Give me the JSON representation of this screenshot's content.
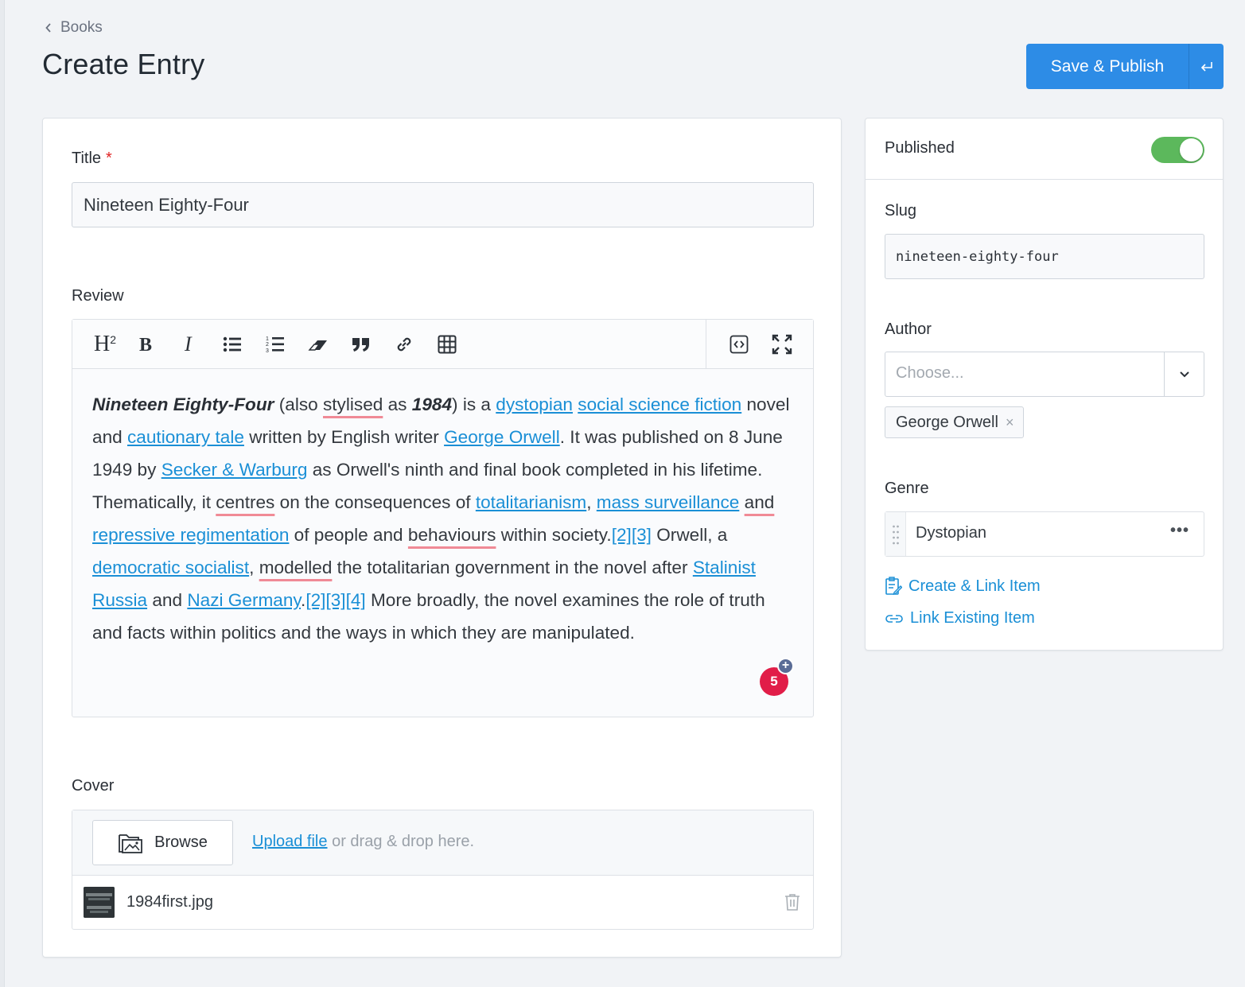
{
  "header": {
    "breadcrumb": "Books",
    "title": "Create Entry",
    "publish_label": "Save & Publish"
  },
  "form": {
    "title_label": "Title",
    "required_mark": "*",
    "title_value": "Nineteen Eighty-Four",
    "review_label": "Review",
    "review": {
      "t1": "Nineteen Eighty-Four",
      "t2": " (also ",
      "t3": "stylised",
      "t4": " as ",
      "t5": "1984",
      "t6": ") is a ",
      "l1": "dystopian",
      "t7": " ",
      "l2": "social science fiction",
      "t8": " novel and ",
      "l3": "cautionary tale",
      "t9": " written by English writer ",
      "l4": "George Orwell",
      "t10": ". It was published on 8 June 1949 by ",
      "l5": "Secker & Warburg",
      "t11": " as Orwell's ninth and final book completed in his lifetime. Thematically, it ",
      "t12": "centres",
      "t13": " on the consequences of ",
      "l6": "totalitarianism",
      "t14": ", ",
      "l7": "mass surveillance",
      "t15": " ",
      "t16": "and",
      "t17": " ",
      "l8": "repressive regimentation",
      "t18": " of people and ",
      "t19": "behaviours",
      "t20": " within society.",
      "l9": "[2]",
      "l10": "[3]",
      "t21": " Orwell, a ",
      "l11": "democratic socialist",
      "t22": ", ",
      "t23": "modelled",
      "t24": " the totalitarian government in the novel after ",
      "l12": "Stalinist Russia",
      "t25": " and ",
      "l13": "Nazi Germany",
      "t26": ".",
      "l14": "[2]",
      "l15": "[3]",
      "l16": "[4]",
      "t27": " More broadly, the novel examines the role of truth and facts within politics and the ways in which they are manipulated."
    },
    "grammar_count": "5",
    "grammar_plus": "+",
    "cover_label": "Cover",
    "browse_label": "Browse",
    "upload_link": "Upload file",
    "upload_hint": " or drag & drop here.",
    "file_name": "1984first.jpg"
  },
  "toolbar": {
    "icons": [
      "heading-icon",
      "bold-icon",
      "italic-icon",
      "bullet-list-icon",
      "ordered-list-icon",
      "eraser-icon",
      "quote-icon",
      "link-icon",
      "table-icon",
      "code-view-icon",
      "fullscreen-icon"
    ]
  },
  "sidebar": {
    "published_label": "Published",
    "published_on": true,
    "slug_label": "Slug",
    "slug_value": "nineteen-eighty-four",
    "author_label": "Author",
    "author_placeholder": "Choose...",
    "author_tag": "George Orwell",
    "author_tag_remove": "×",
    "genre_label": "Genre",
    "genre_item": "Dystopian",
    "genre_more": "•••",
    "create_link": "Create & Link Item",
    "link_existing": "Link Existing Item"
  },
  "colors": {
    "accent": "#2d8ce6",
    "link": "#1a8fd6",
    "toggle_on": "#5cb85c",
    "badge": "#e11d48"
  }
}
